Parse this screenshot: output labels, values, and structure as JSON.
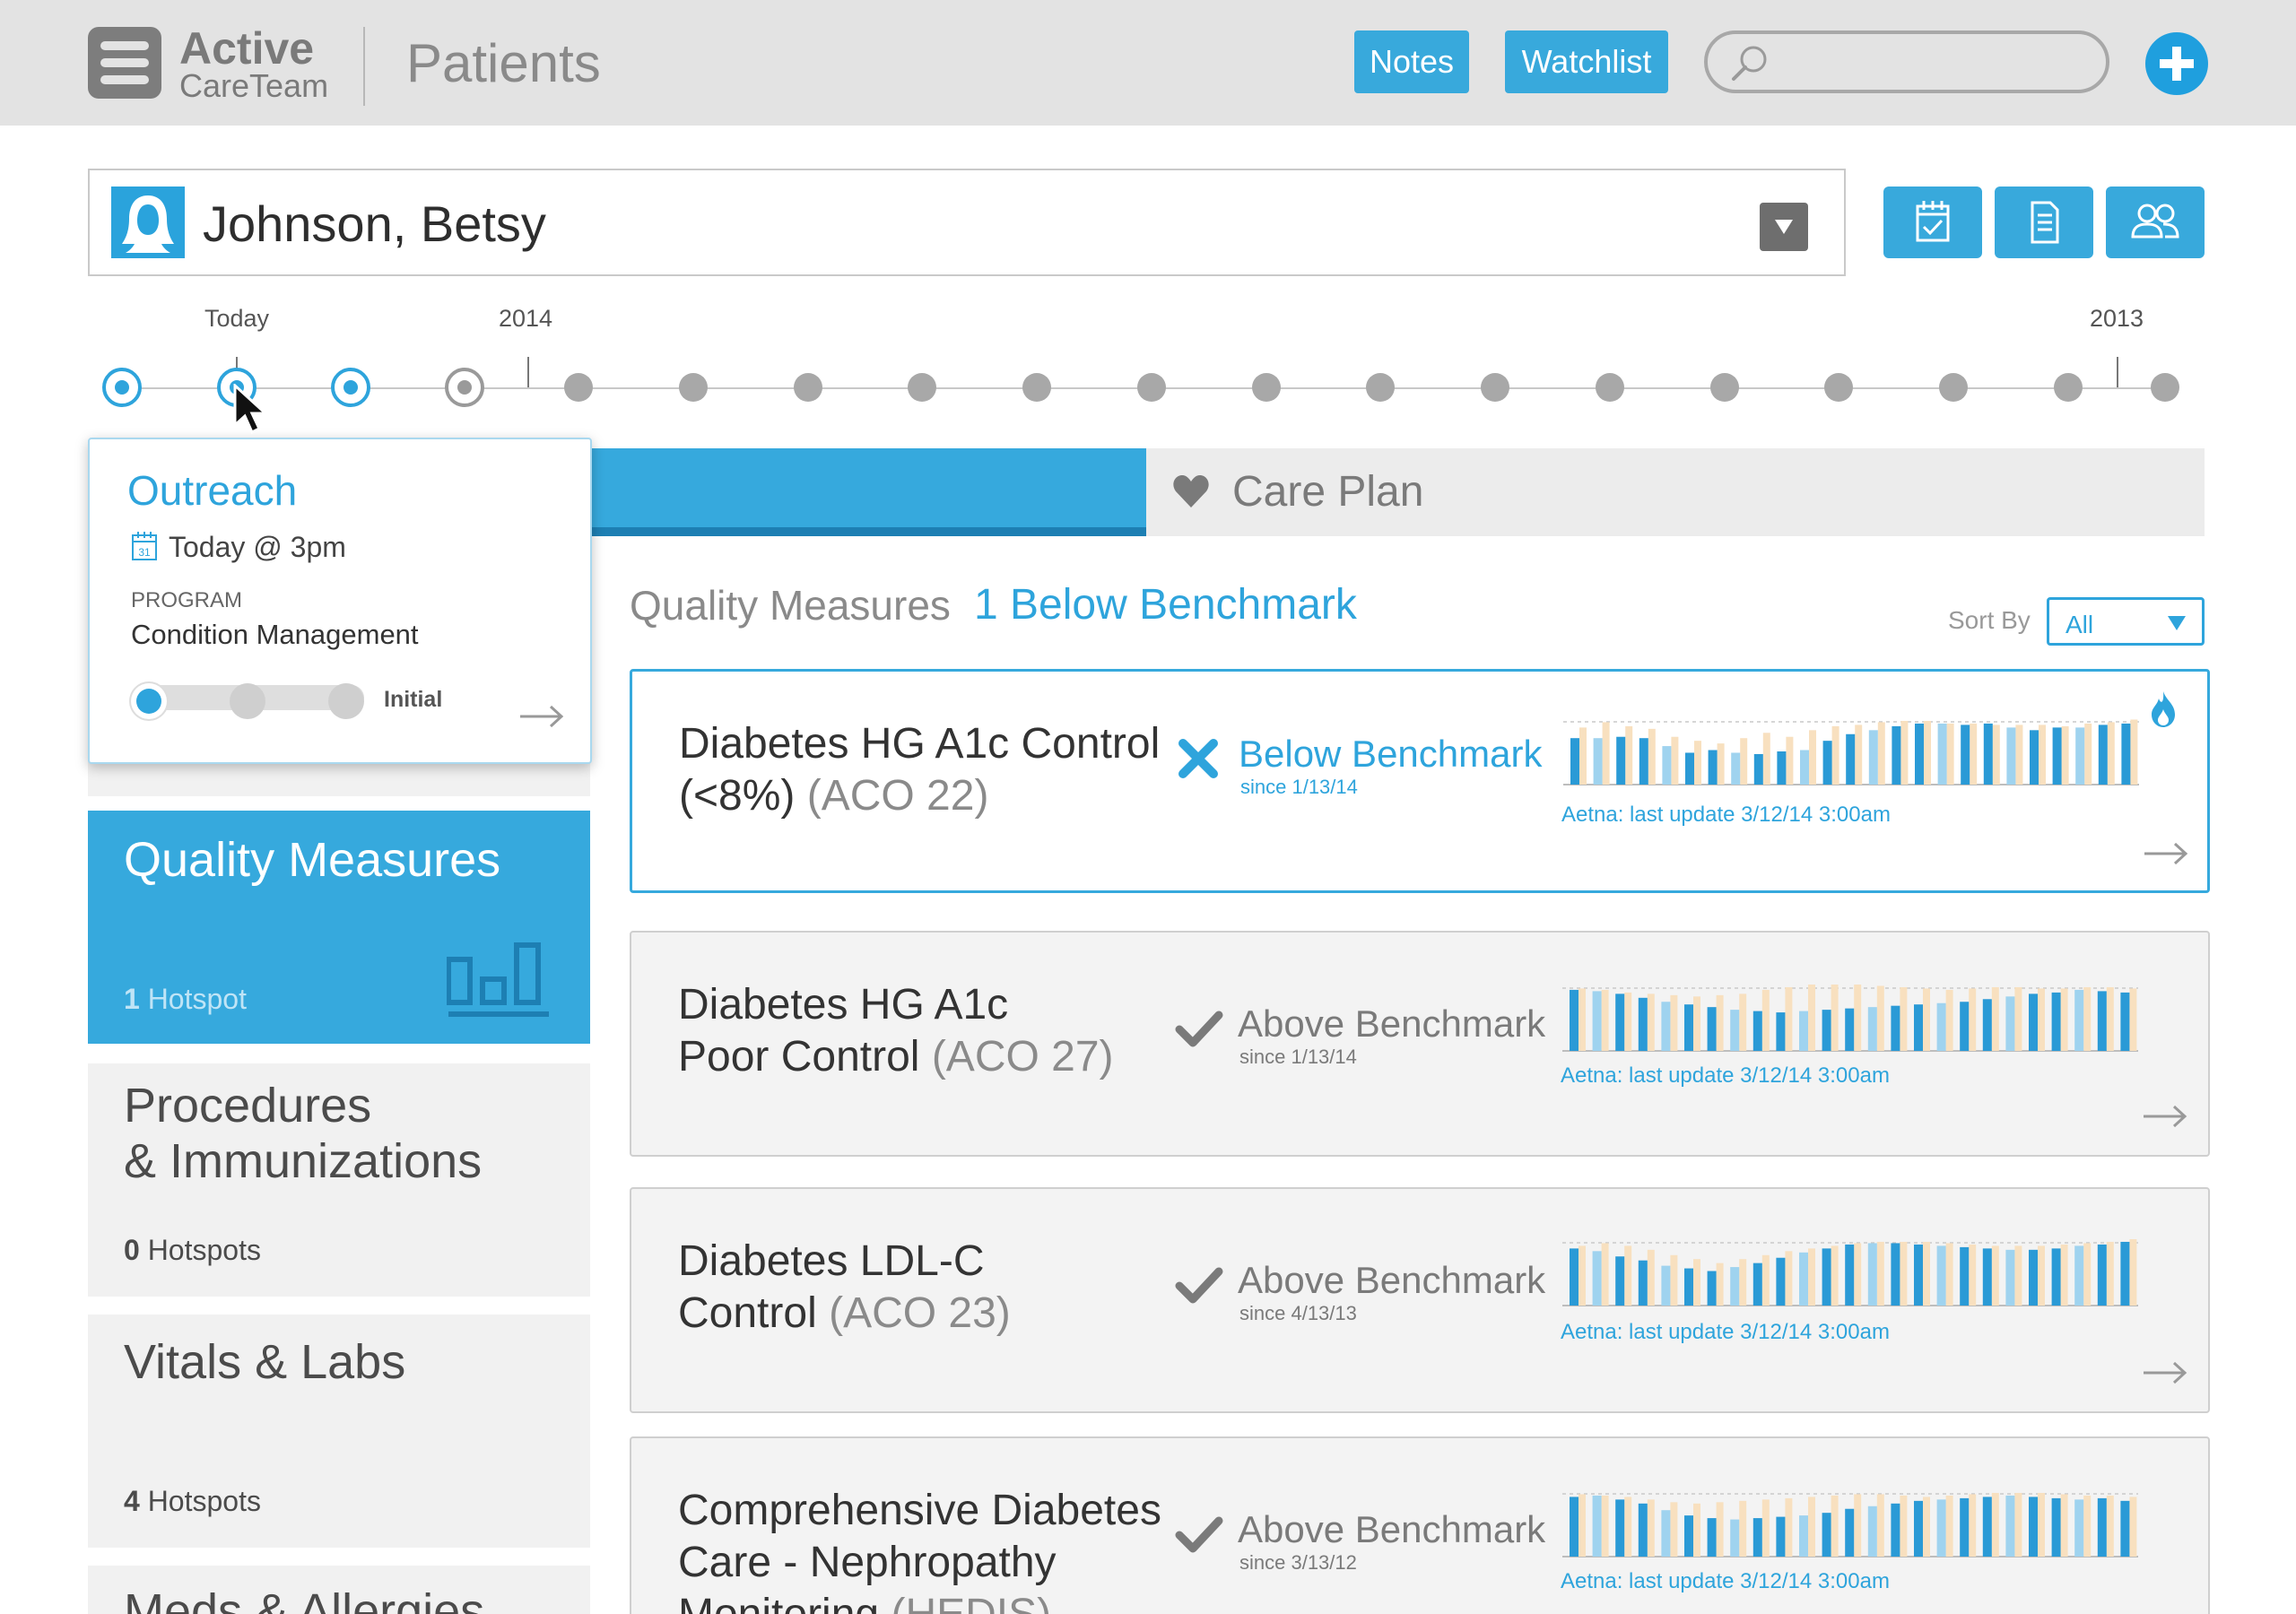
{
  "app": {
    "brand_line1": "Active",
    "brand_line2": "CareTeam",
    "page_title": "Patients"
  },
  "topbar": {
    "notes_label": "Notes",
    "watchlist_label": "Watchlist",
    "search_placeholder": ""
  },
  "patient": {
    "name": "Johnson, Betsy"
  },
  "timeline": {
    "today_label": "Today",
    "year_2014": "2014",
    "year_2013": "2013"
  },
  "tabs": {
    "care_plan_label": "Care Plan"
  },
  "popup": {
    "title": "Outreach",
    "when": "Today @ 3pm",
    "calendar_day": "31",
    "program_label": "PROGRAM",
    "program_value": "Condition Management",
    "stage_label": "Initial"
  },
  "sidebar": {
    "items": [
      {
        "title": "Quality Measures",
        "count": "1",
        "suffix": "Hotspot",
        "active": true
      },
      {
        "title_line1": "Procedures",
        "title_line2": "& Immunizations",
        "count": "0",
        "suffix": "Hotspots"
      },
      {
        "title": "Vitals & Labs",
        "count": "4",
        "suffix": "Hotspots"
      },
      {
        "title": "Meds & Allergies"
      }
    ]
  },
  "quality": {
    "title": "Quality Measures",
    "below_summary": "1 Below Benchmark",
    "sort_label": "Sort By",
    "sort_value": "All"
  },
  "measures": [
    {
      "name_line1": "Diabetes HG A1c Control",
      "name_line2": "(<8%)",
      "code": "(ACO 22)",
      "status": "Below Benchmark",
      "since": "since 1/13/14",
      "updated": "Aetna: last update 3/12/14 3:00am",
      "state": "below"
    },
    {
      "name_line1": "Diabetes HG A1c",
      "name_line2": "Poor Control",
      "code": "(ACO 27)",
      "status": "Above Benchmark",
      "since": "since 1/13/14",
      "updated": "Aetna: last update 3/12/14 3:00am",
      "state": "above"
    },
    {
      "name_line1": "Diabetes LDL-C",
      "name_line2": "Control",
      "code": "(ACO 23)",
      "status": "Above Benchmark",
      "since": "since 4/13/13",
      "updated": "Aetna: last update 3/12/14 3:00am",
      "state": "above"
    },
    {
      "name_line1": "Comprehensive Diabetes",
      "name_line2": "Care - Nephropathy",
      "name_line3": "Monitoring",
      "code": "(HEDIS)",
      "status": "Above Benchmark",
      "since": "since 3/13/12",
      "updated": "Aetna: last update 3/12/14 3:00am",
      "state": "above"
    }
  ],
  "colors": {
    "accent": "#36a9dd",
    "accent_dark": "#1d7fb3",
    "bar_dark": "#2a9ad6",
    "bar_light": "#9fd3ef",
    "bar_peach": "#f8e0bf",
    "check_gray": "#7a7a7a"
  },
  "chart_data": [
    {
      "type": "bar",
      "title": "",
      "series": [
        {
          "values": [
            0.7,
            0.7,
            0.72,
            0.7,
            0.58,
            0.48,
            0.52,
            0.48,
            0.46,
            0.5,
            0.52,
            0.66,
            0.76,
            0.82,
            0.88,
            0.92,
            0.92,
            0.9,
            0.92,
            0.86,
            0.82,
            0.86,
            0.86,
            0.9,
            0.92
          ]
        },
        {
          "values": [
            0.86,
            0.94,
            0.88,
            0.84,
            0.72,
            0.66,
            0.62,
            0.7,
            0.78,
            0.72,
            0.82,
            0.88,
            0.9,
            0.94,
            0.96,
            0.96,
            0.92,
            0.92,
            0.9,
            0.9,
            0.9,
            0.88,
            0.92,
            0.94,
            0.98
          ]
        }
      ]
    },
    {
      "type": "bar",
      "title": "",
      "series": [
        {
          "values": [
            0.92,
            0.9,
            0.86,
            0.8,
            0.74,
            0.7,
            0.66,
            0.62,
            0.6,
            0.58,
            0.6,
            0.62,
            0.64,
            0.66,
            0.68,
            0.7,
            0.72,
            0.74,
            0.78,
            0.82,
            0.86,
            0.88,
            0.92,
            0.9,
            0.88
          ]
        },
        {
          "values": [
            0.94,
            0.92,
            0.88,
            0.86,
            0.84,
            0.82,
            0.84,
            0.86,
            0.92,
            0.96,
            1.0,
            1.0,
            1.0,
            0.98,
            0.96,
            0.94,
            0.92,
            0.94,
            0.96,
            0.96,
            0.94,
            0.94,
            0.96,
            0.96,
            0.94
          ]
        }
      ]
    },
    {
      "type": "bar",
      "title": "",
      "series": [
        {
          "values": [
            0.86,
            0.82,
            0.74,
            0.68,
            0.6,
            0.56,
            0.52,
            0.58,
            0.64,
            0.72,
            0.8,
            0.86,
            0.92,
            0.94,
            0.94,
            0.92,
            0.9,
            0.88,
            0.86,
            0.84,
            0.84,
            0.86,
            0.9,
            0.92,
            0.96
          ]
        },
        {
          "values": [
            0.9,
            0.94,
            0.9,
            0.84,
            0.76,
            0.7,
            0.64,
            0.7,
            0.76,
            0.82,
            0.86,
            0.9,
            0.94,
            0.96,
            0.96,
            0.96,
            0.94,
            0.92,
            0.9,
            0.9,
            0.9,
            0.92,
            0.94,
            0.96,
            1.0
          ]
        }
      ]
    },
    {
      "type": "bar",
      "title": "",
      "series": [
        {
          "values": [
            0.9,
            0.92,
            0.86,
            0.8,
            0.7,
            0.62,
            0.58,
            0.56,
            0.58,
            0.6,
            0.62,
            0.66,
            0.72,
            0.76,
            0.8,
            0.84,
            0.86,
            0.88,
            0.9,
            0.92,
            0.9,
            0.88,
            0.86,
            0.88,
            0.84
          ]
        },
        {
          "values": [
            0.94,
            0.92,
            0.9,
            0.86,
            0.82,
            0.8,
            0.82,
            0.84,
            0.86,
            0.88,
            0.9,
            0.92,
            0.94,
            0.94,
            0.92,
            0.9,
            0.92,
            0.94,
            0.96,
            0.96,
            0.96,
            0.94,
            0.92,
            0.92,
            0.9
          ]
        }
      ]
    }
  ]
}
